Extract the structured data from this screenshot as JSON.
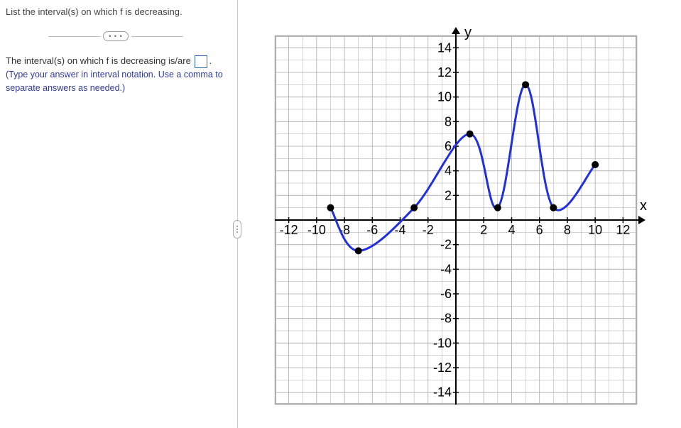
{
  "question": "List the interval(s) on which f is decreasing.",
  "ellipsis": "•  •  •",
  "answer_prompt": "The interval(s) on which f is decreasing is/are",
  "answer_suffix": ".",
  "hint": "(Type your answer in interval notation. Use a comma to separate answers as needed.)",
  "chart_data": {
    "type": "line",
    "title": "",
    "xlabel": "x",
    "ylabel": "y",
    "xlim": [
      -13,
      13
    ],
    "ylim": [
      -15,
      15
    ],
    "xticks": [
      -12,
      -10,
      -8,
      -6,
      -4,
      -2,
      2,
      4,
      6,
      8,
      10,
      12
    ],
    "yticks": [
      -14,
      -12,
      -10,
      -8,
      -6,
      -4,
      -2,
      2,
      4,
      6,
      8,
      10,
      12,
      14
    ],
    "grid": true,
    "series": [
      {
        "name": "f",
        "color": "#2030e0",
        "points": [
          {
            "x": -9,
            "y": 1
          },
          {
            "x": -7,
            "y": -2.5
          },
          {
            "x": -3,
            "y": 1
          },
          {
            "x": 1,
            "y": 7
          },
          {
            "x": 3,
            "y": 1
          },
          {
            "x": 5,
            "y": 11
          },
          {
            "x": 7,
            "y": 1
          },
          {
            "x": 10,
            "y": 4.5
          }
        ]
      }
    ]
  }
}
